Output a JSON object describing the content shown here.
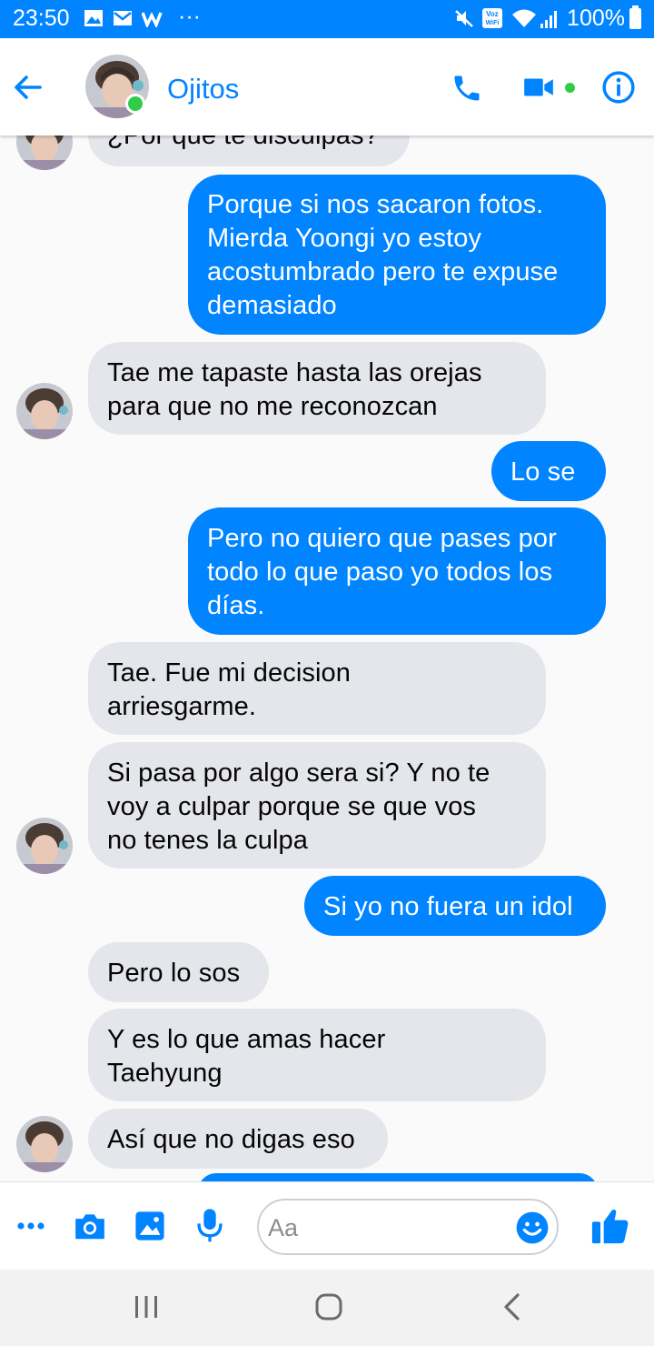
{
  "status_bar": {
    "time": "23:50",
    "dots": "···",
    "battery": "100%",
    "icons": [
      "gallery-icon",
      "email-icon",
      "w-app-icon",
      "mute-icon",
      "vowifi-icon",
      "wifi-icon",
      "signal-icon",
      "battery-icon"
    ]
  },
  "header": {
    "contact_name": "Ojitos",
    "online": true,
    "icons": [
      "back-arrow-icon",
      "phone-icon",
      "video-icon",
      "info-icon"
    ]
  },
  "messages": [
    {
      "from": "them",
      "text": "¿Por que te disculpas?"
    },
    {
      "from": "me",
      "text": "Porque si nos sacaron fotos.\nMierda Yoongi yo estoy\nacostumbrado pero te expuse\ndemasiado"
    },
    {
      "from": "them",
      "text": "Tae me tapaste hasta las orejas\npara que no me reconozcan"
    },
    {
      "from": "me",
      "text": "Lo se"
    },
    {
      "from": "me",
      "text": "Pero no quiero que pases por\ntodo lo que paso yo todos los\ndías."
    },
    {
      "from": "them",
      "text": "Tae. Fue mi decision\narriesgarme."
    },
    {
      "from": "them",
      "text": "Si pasa por algo sera si? Y no te\nvoy a culpar porque se que vos\nno tenes la culpa"
    },
    {
      "from": "me",
      "text": "Si yo no fuera un idol"
    },
    {
      "from": "them",
      "text": "Pero lo sos"
    },
    {
      "from": "them",
      "text": "Y es lo que amas hacer\nTaehyung"
    },
    {
      "from": "them",
      "text": "Así que no digas eso"
    }
  ],
  "composer": {
    "placeholder": "Aa",
    "icons": [
      "more-icon",
      "camera-icon",
      "image-icon",
      "microphone-icon",
      "emoji-icon",
      "like-icon"
    ]
  },
  "colors": {
    "accent": "#0084ff",
    "incoming_bubble": "#e4e6eb",
    "online": "#31cc46"
  }
}
